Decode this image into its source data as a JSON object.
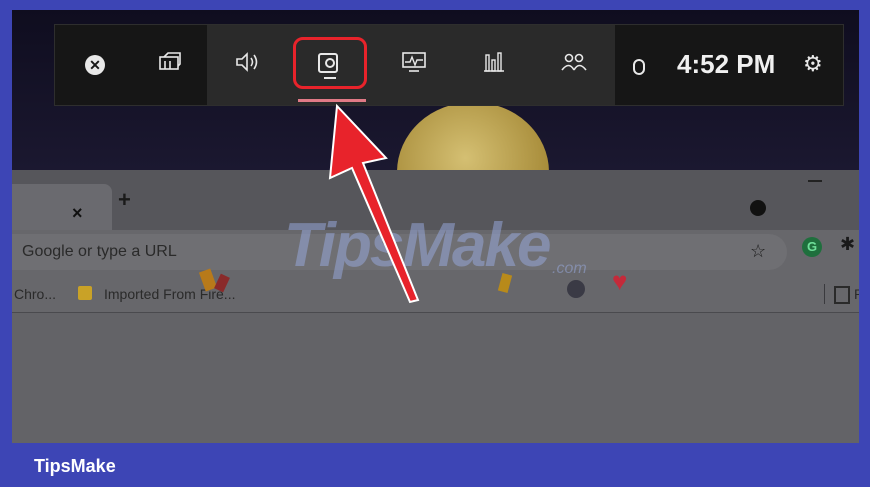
{
  "gamebar": {
    "time": "4:52 PM",
    "widgets": [
      {
        "name": "xbox",
        "icon": "xbox-icon"
      },
      {
        "name": "widget-menu",
        "icon": "widget-menu-icon"
      },
      {
        "name": "audio",
        "icon": "speaker-icon"
      },
      {
        "name": "capture",
        "icon": "webcam-capture-icon",
        "active": true
      },
      {
        "name": "performance",
        "icon": "monitor-performance-icon"
      },
      {
        "name": "resources",
        "icon": "bar-chart-icon"
      },
      {
        "name": "social",
        "icon": "people-icon"
      },
      {
        "name": "mouse",
        "icon": "mouse-icon"
      },
      {
        "name": "settings",
        "icon": "gear-icon"
      }
    ],
    "highlight_color": "#e8232b"
  },
  "browser": {
    "new_tab_label": "+",
    "close_tab_label": "×",
    "omnibox_placeholder": "Google or type a URL",
    "bookmarks": [
      "Chro...",
      "Imported From Fire...",
      "R"
    ],
    "extension_letter": "G"
  },
  "watermark": {
    "text": "TipsMake",
    "domain": ".com"
  },
  "footer": {
    "brand": "TipsMake"
  },
  "colors": {
    "frame": "#3d45b5",
    "gamebar_bg": "#161616",
    "arrow": "#e8232b"
  }
}
